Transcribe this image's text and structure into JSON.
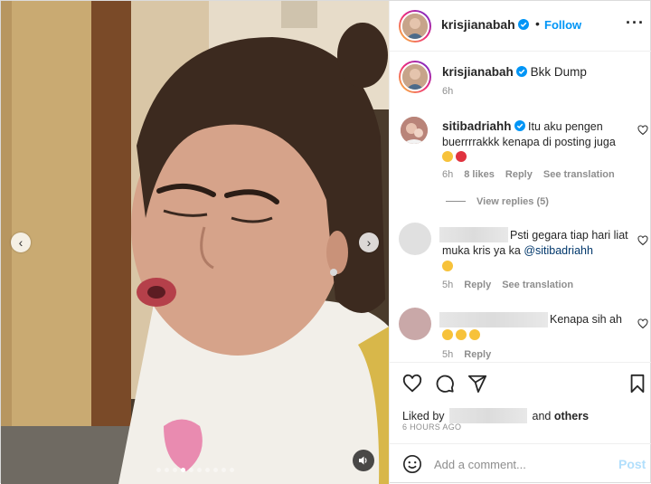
{
  "post": {
    "author": "krisjianabah",
    "follow_label": "Follow",
    "caption": "Bkk Dump",
    "caption_time": "6h",
    "more_icon": "more-horizontal-icon"
  },
  "media": {
    "slide_count": 10,
    "active_slide": 3
  },
  "comments": [
    {
      "username": "sitibadriahh",
      "text": "Itu aku pengen buerrrrakkk kenapa di posting juga",
      "time": "6h",
      "likes": "8 likes",
      "reply_label": "Reply",
      "translate_label": "See translation",
      "view_replies": "View replies (5)"
    },
    {
      "username": "",
      "text": "Psti gegara tiap hari liat muka kris ya ka ",
      "mention": "@sitibadriahh",
      "time": "5h",
      "reply_label": "Reply",
      "translate_label": "See translation"
    },
    {
      "username": "",
      "text": "Kenapa sih ah",
      "time": "5h",
      "reply_label": "Reply"
    }
  ],
  "footer": {
    "liked_by_prefix": "Liked by",
    "liked_by_suffix": "and",
    "others": "others",
    "timestamp": "6 HOURS AGO",
    "comment_placeholder": "Add a comment...",
    "post_label": "Post"
  },
  "colors": {
    "link_blue": "#0095f6",
    "meta_gray": "#8e8e8e",
    "post_disabled": "#b2dffc"
  }
}
